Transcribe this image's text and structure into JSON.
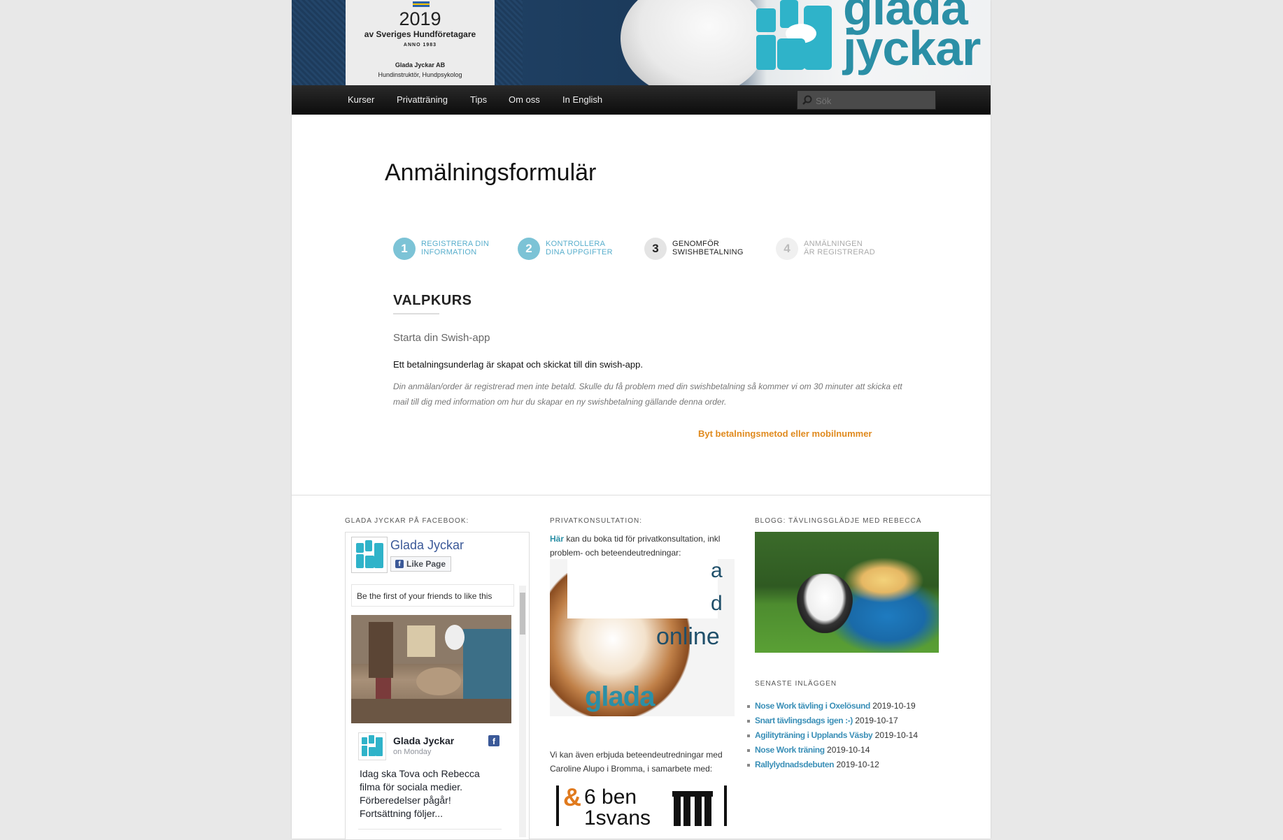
{
  "header": {
    "award": {
      "year": "2019",
      "org": "av Sveriges Hundföretagare",
      "anno": "ANNO 1983",
      "company": "Glada Jyckar AB",
      "subtitle": "Hundinstruktör, Hundpsykolog"
    },
    "logo_text_1": "glada",
    "logo_text_2": "jyckar"
  },
  "nav": {
    "items": [
      "Kurser",
      "Privatträning",
      "Tips",
      "Om oss",
      "In English"
    ],
    "search_placeholder": "Sök"
  },
  "main": {
    "title": "Anmälningsformulär",
    "steps": [
      {
        "num": "1",
        "line1": "REGISTRERA DIN",
        "line2": "INFORMATION",
        "state": "done"
      },
      {
        "num": "2",
        "line1": "KONTROLLERA",
        "line2": "DINA UPPGIFTER",
        "state": "done"
      },
      {
        "num": "3",
        "line1": "GENOMFÖR",
        "line2": "SWISHBETALNING",
        "state": "current"
      },
      {
        "num": "4",
        "line1": "ANMÄLNINGEN",
        "line2": "ÄR REGISTRERAD",
        "state": "todo"
      }
    ],
    "course": "VALPKURS",
    "swish_prompt": "Starta din Swish-app",
    "message": "Ett betalningsunderlag är skapat och skickat till din swish-app.",
    "note": "Din anmälan/order är registrerad men inte betald. Skulle du få problem med din swishbetalning så kommer vi om 30 minuter att skicka ett mail till dig med information om hur du skapar en ny swishbetalning gällande denna order.",
    "change_link": "Byt betalningsmetod eller mobilnummer"
  },
  "footer": {
    "facebook": {
      "title": "GLADA JYCKAR PÅ FACEBOOK:",
      "page_name": "Glada Jyckar",
      "like_label": "Like Page",
      "friends_text": "Be the first of your friends to like this",
      "post_author": "Glada Jyckar",
      "post_time": "on Monday",
      "post_text": "Idag ska Tova och Rebecca filma för sociala medier. Förberedelser pågår! Fortsättning följer..."
    },
    "private": {
      "title": "PRIVATKONSULTATION:",
      "link": "Här",
      "text": " kan du boka tid för privatkonsultation, inkl problem- och beteendeutredningar:",
      "ad_text_1": "a",
      "ad_text_2": "d",
      "ad_online": "online",
      "ad_brand": "glada jyckar",
      "collab_text": "Vi kan även erbjuda beteendeutredningar med Caroline Alupo i Bromma, i samarbete med:",
      "partner_logo": "6 ben & 1 svans"
    },
    "blog": {
      "title": "BLOGG: TÄVLINGSGLÄDJE MED REBECCA",
      "recent_title": "SENASTE INLÄGGEN",
      "posts": [
        {
          "title": "Nose Work tävling i Oxelösund",
          "date": "2019-10-19"
        },
        {
          "title": "Snart tävlingsdags igen :-)",
          "date": "2019-10-17"
        },
        {
          "title": "Agilityträning i Upplands Väsby",
          "date": "2019-10-14"
        },
        {
          "title": "Nose Work träning",
          "date": "2019-10-14"
        },
        {
          "title": "Rallylydnadsdebuten",
          "date": "2019-10-12"
        }
      ]
    }
  },
  "colors": {
    "brand_teal": "#2b8fa6",
    "step_done": "#58aecc",
    "accent_orange": "#e08a1e",
    "fb_blue": "#3b5998"
  }
}
